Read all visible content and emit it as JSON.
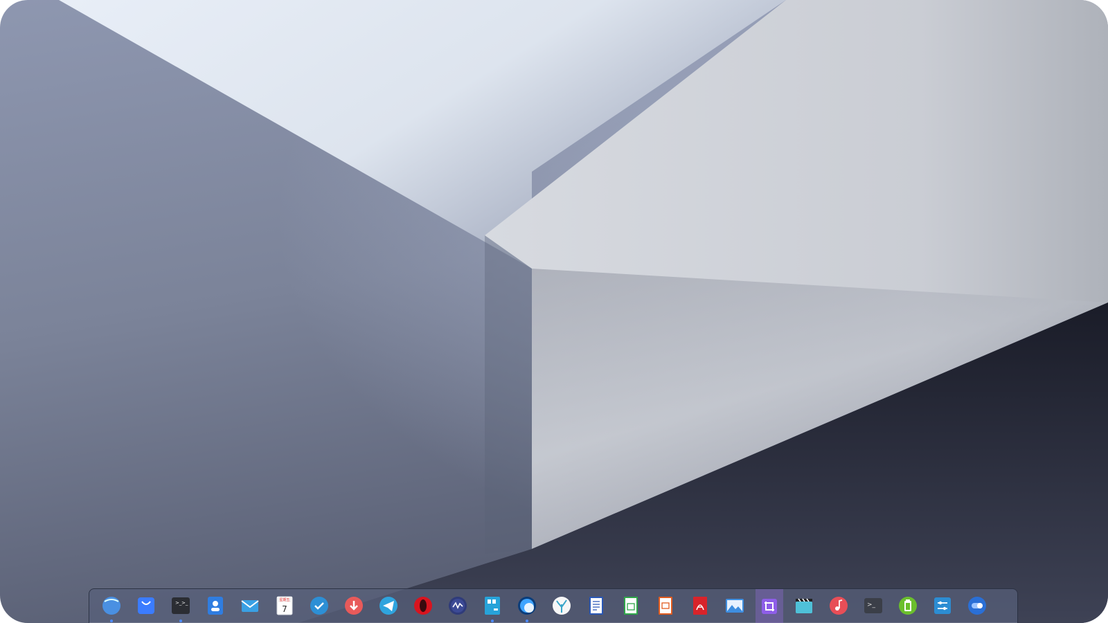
{
  "desktop": {
    "wallpaper_colors": [
      "#e6ecf5",
      "#9ba5bd",
      "#5a6177",
      "#d2d6dc",
      "#1d1f2c"
    ]
  },
  "dock": {
    "items": [
      {
        "name": "launcher-icon",
        "running": true
      },
      {
        "name": "app-store-icon",
        "running": false
      },
      {
        "name": "terminal-icon",
        "running": true
      },
      {
        "name": "contacts-icon",
        "running": false
      },
      {
        "name": "mail-icon",
        "running": false
      },
      {
        "name": "calendar-icon",
        "running": false,
        "calendar_label": "星期五",
        "calendar_day": "7"
      },
      {
        "name": "tasks-icon",
        "running": false
      },
      {
        "name": "downloader-icon",
        "running": false
      },
      {
        "name": "telegram-icon",
        "running": false
      },
      {
        "name": "opera-icon",
        "running": false
      },
      {
        "name": "system-monitor-icon",
        "running": false
      },
      {
        "name": "notes-icon",
        "running": true
      },
      {
        "name": "browser-icon",
        "running": true
      },
      {
        "name": "coral-icon",
        "running": false
      },
      {
        "name": "writer-icon",
        "running": false
      },
      {
        "name": "calc-icon",
        "running": false
      },
      {
        "name": "impress-icon",
        "running": false
      },
      {
        "name": "pdf-icon",
        "running": false
      },
      {
        "name": "image-viewer-icon",
        "running": false
      },
      {
        "name": "screenshot-crop-icon",
        "running": false,
        "active": true
      },
      {
        "name": "video-icon",
        "running": false
      },
      {
        "name": "music-icon",
        "running": false
      },
      {
        "name": "console-icon",
        "running": false
      },
      {
        "name": "battery-icon",
        "running": false
      },
      {
        "name": "settings-icon",
        "running": false
      },
      {
        "name": "toggle-icon",
        "running": false
      }
    ]
  }
}
